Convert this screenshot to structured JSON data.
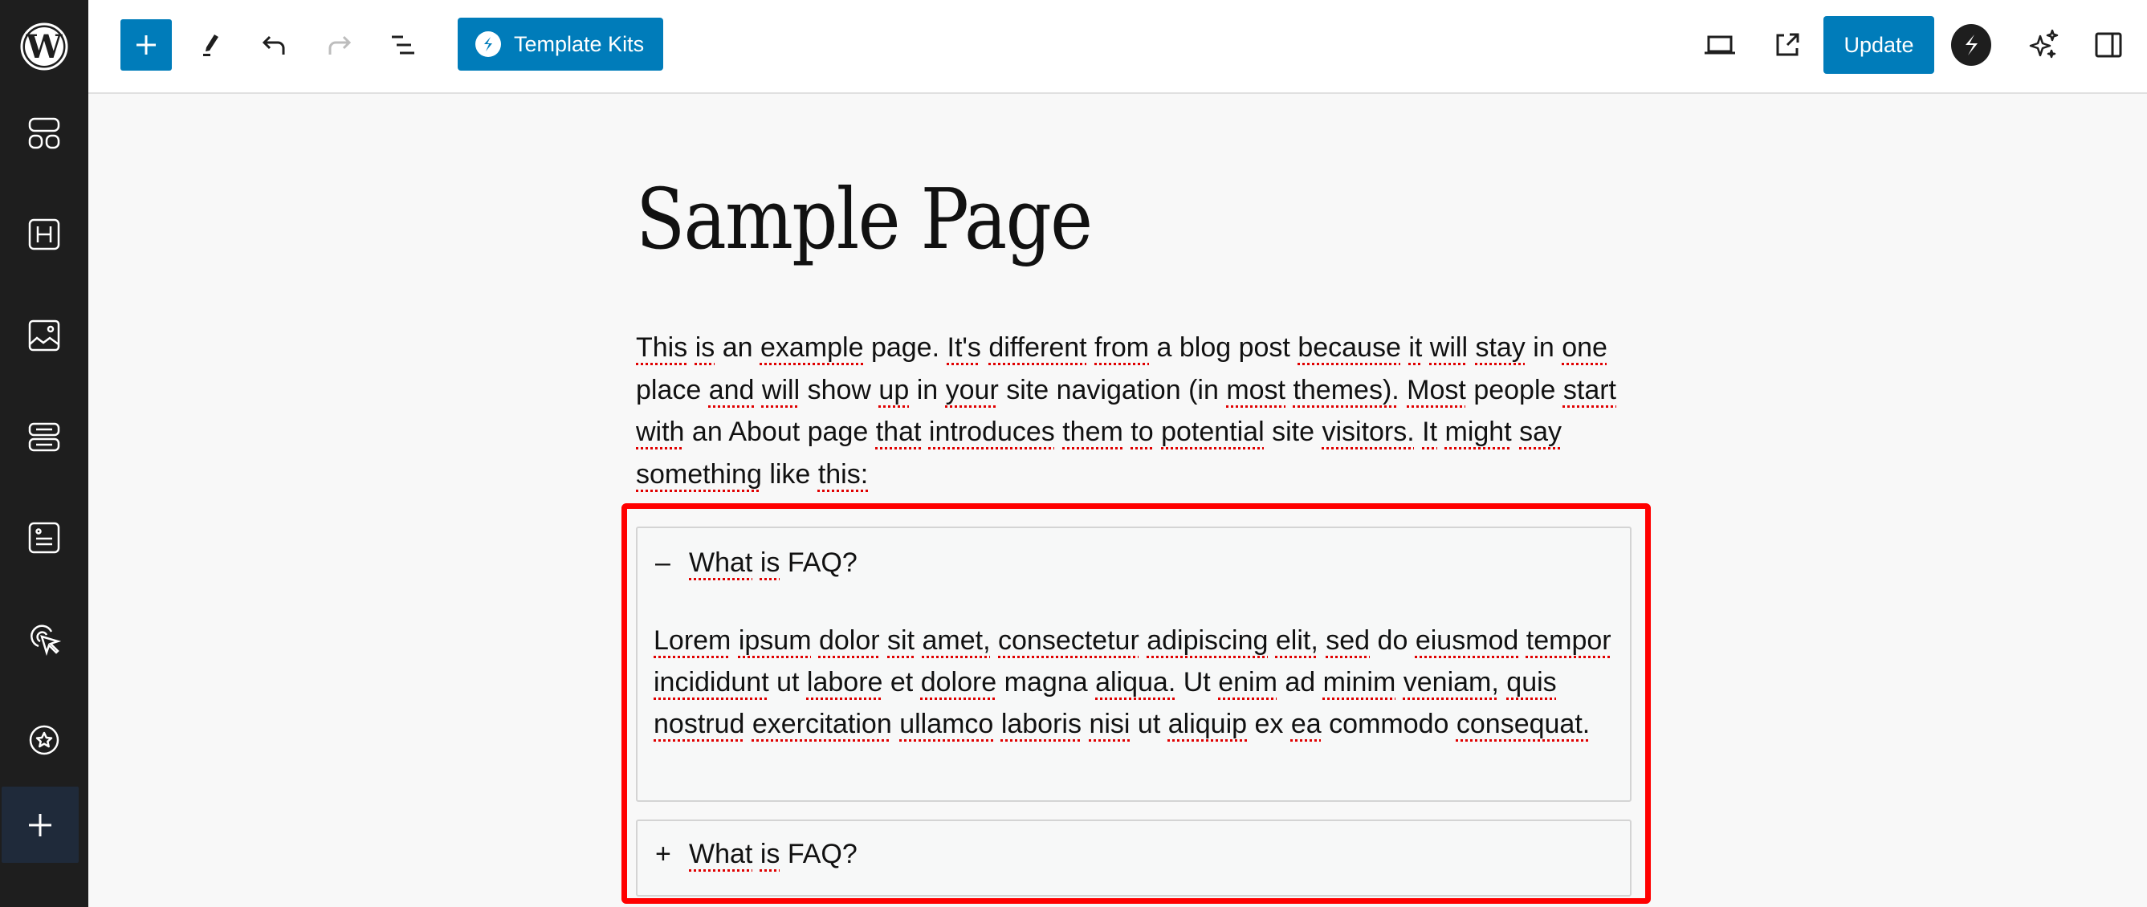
{
  "header": {
    "template_kits_label": "Template Kits",
    "update_label": "Update",
    "icons": [
      "add-block-icon",
      "edit-tool-icon",
      "undo-icon",
      "redo-icon",
      "document-overview-icon",
      "desktop-preview-icon",
      "view-page-external-icon",
      "site-logo-s-icon",
      "ai-sparkles-icon",
      "settings-sidebar-icon"
    ]
  },
  "sidebar": {
    "items": [
      {
        "name": "wordpress-logo"
      },
      {
        "name": "patterns"
      },
      {
        "name": "heading"
      },
      {
        "name": "image"
      },
      {
        "name": "rows"
      },
      {
        "name": "form"
      },
      {
        "name": "click-interaction"
      },
      {
        "name": "favorites"
      },
      {
        "name": "add"
      }
    ]
  },
  "page": {
    "title": "Sample Page",
    "intro_words": [
      [
        "This",
        true
      ],
      [
        "is",
        true
      ],
      [
        "an",
        false
      ],
      [
        "example",
        true
      ],
      [
        "page.",
        false
      ],
      [
        "It's",
        true
      ],
      [
        "different",
        true
      ],
      [
        "from",
        true
      ],
      [
        "a",
        false
      ],
      [
        "blog",
        false
      ],
      [
        "post",
        false
      ],
      [
        "because",
        true
      ],
      [
        "it",
        true
      ],
      [
        "will",
        true
      ],
      [
        "stay",
        true
      ],
      [
        "in",
        false
      ],
      [
        "one",
        true
      ],
      [
        "place",
        false
      ],
      [
        "and",
        true
      ],
      [
        "will",
        true
      ],
      [
        "show",
        false
      ],
      [
        "up",
        true
      ],
      [
        "in",
        false
      ],
      [
        "your",
        true
      ],
      [
        "site",
        false
      ],
      [
        "navigation",
        false
      ],
      [
        "(in",
        false
      ],
      [
        "most",
        true
      ],
      [
        "themes).",
        true
      ],
      [
        "Most",
        true
      ],
      [
        "people",
        false
      ],
      [
        "start",
        true
      ],
      [
        "with",
        true
      ],
      [
        "an",
        false
      ],
      [
        "About",
        false
      ],
      [
        "page",
        false
      ],
      [
        "that",
        true
      ],
      [
        "introduces",
        true
      ],
      [
        "them",
        true
      ],
      [
        "to",
        true
      ],
      [
        "potential",
        true
      ],
      [
        "site",
        false
      ],
      [
        "visitors.",
        true
      ],
      [
        "It",
        true
      ],
      [
        "might",
        true
      ],
      [
        "say",
        true
      ],
      [
        "something",
        true
      ],
      [
        "like",
        false
      ],
      [
        "this:",
        true
      ]
    ]
  },
  "faq": {
    "items": [
      {
        "toggle": "–",
        "question": "What is FAQ?",
        "expanded": true,
        "answer_words": [
          [
            "Lorem",
            true
          ],
          [
            "ipsum",
            true
          ],
          [
            "dolor",
            true
          ],
          [
            "sit",
            true
          ],
          [
            "amet,",
            true
          ],
          [
            "consectetur",
            true
          ],
          [
            "adipiscing",
            true
          ],
          [
            "elit,",
            true
          ],
          [
            "sed",
            true
          ],
          [
            "do",
            false
          ],
          [
            "eiusmod",
            true
          ],
          [
            "tempor",
            true
          ],
          [
            "incididunt",
            true
          ],
          [
            "ut",
            false
          ],
          [
            "labore",
            true
          ],
          [
            "et",
            false
          ],
          [
            "dolore",
            true
          ],
          [
            "magna",
            false
          ],
          [
            "aliqua.",
            true
          ],
          [
            "Ut",
            false
          ],
          [
            "enim",
            true
          ],
          [
            "ad",
            false
          ],
          [
            "minim",
            true
          ],
          [
            "veniam,",
            true
          ],
          [
            "quis",
            true
          ],
          [
            "nostrud",
            true
          ],
          [
            "exercitation",
            true
          ],
          [
            "ullamco",
            true
          ],
          [
            "laboris",
            true
          ],
          [
            "nisi",
            true
          ],
          [
            "ut",
            false
          ],
          [
            "aliquip",
            true
          ],
          [
            "ex",
            false
          ],
          [
            "ea",
            true
          ],
          [
            "commodo",
            false
          ],
          [
            "consequat.",
            true
          ]
        ]
      },
      {
        "toggle": "+",
        "question": "What is FAQ?",
        "expanded": false
      }
    ]
  },
  "colors": {
    "accent": "#007cba",
    "sidebar_bg": "#1e1e1e",
    "highlight": "#ff0000",
    "spellcheck": "#e00000"
  }
}
